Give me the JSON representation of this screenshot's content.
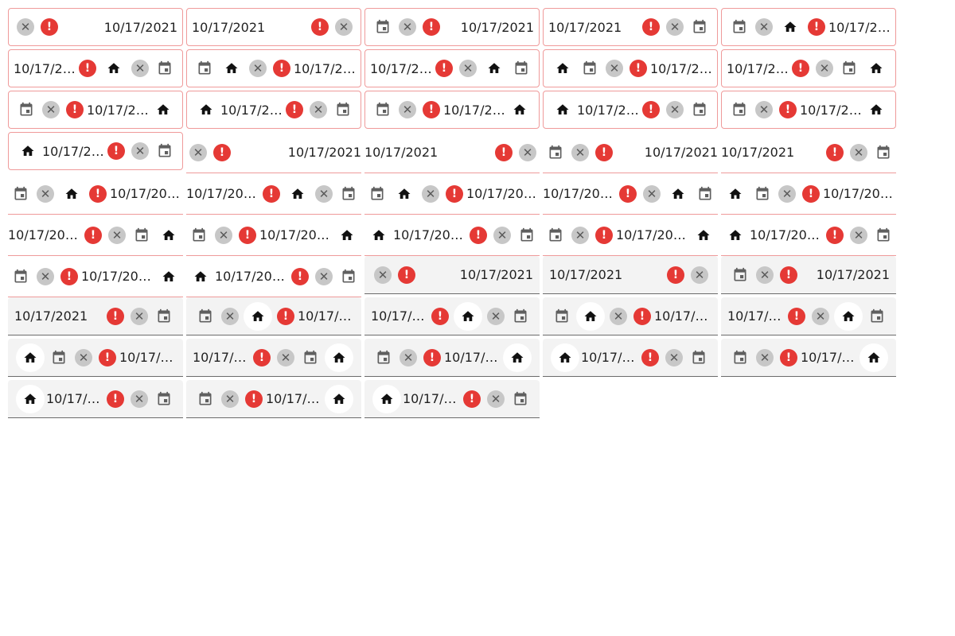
{
  "value": "10/17/2021",
  "colors": {
    "error": "#e53935",
    "clear_bg": "#c7c7c7",
    "outline": "#ef9a9a",
    "filled_bg": "#f3f3f3"
  },
  "icons": {
    "error": "exclamation-circle-icon",
    "clear": "clear-circle-icon",
    "calendar": "calendar-icon",
    "home": "home-icon"
  },
  "fields": [
    {
      "variant": "outlined",
      "layout": [
        "clr",
        "err",
        "date:right"
      ]
    },
    {
      "variant": "outlined",
      "layout": [
        "date:left",
        "err",
        "clr"
      ]
    },
    {
      "variant": "outlined",
      "layout": [
        "cal",
        "clr",
        "err",
        "date:right"
      ]
    },
    {
      "variant": "outlined",
      "layout": [
        "date:left",
        "err",
        "clr",
        "cal"
      ]
    },
    {
      "variant": "outlined",
      "layout": [
        "cal",
        "clr",
        "home",
        "err",
        "date:right"
      ]
    },
    {
      "variant": "outlined",
      "layout": [
        "date:left",
        "err",
        "home",
        "clr",
        "cal"
      ]
    },
    {
      "variant": "outlined",
      "layout": [
        "cal",
        "home",
        "clr",
        "err",
        "date:right"
      ]
    },
    {
      "variant": "outlined",
      "layout": [
        "date:left",
        "err",
        "clr",
        "home",
        "cal"
      ]
    },
    {
      "variant": "outlined",
      "layout": [
        "home",
        "cal",
        "clr",
        "err",
        "date:right"
      ]
    },
    {
      "variant": "outlined",
      "layout": [
        "date:left",
        "err",
        "clr",
        "cal",
        "home"
      ]
    },
    {
      "variant": "outlined",
      "layout": [
        "cal",
        "clr",
        "err",
        "date:right",
        "home"
      ]
    },
    {
      "variant": "outlined",
      "layout": [
        "home",
        "date:right",
        "err",
        "clr",
        "cal"
      ]
    },
    {
      "variant": "outlined",
      "layout": [
        "cal",
        "clr",
        "err",
        "date:right",
        "home"
      ]
    },
    {
      "variant": "outlined",
      "layout": [
        "home",
        "date:right",
        "err",
        "clr",
        "cal"
      ]
    },
    {
      "variant": "outlined",
      "layout": [
        "cal",
        "clr",
        "err",
        "date:right",
        "home"
      ]
    },
    {
      "variant": "outlined",
      "layout": [
        "home",
        "date:right",
        "err",
        "clr",
        "cal"
      ]
    },
    {
      "variant": "underlined",
      "layout": [
        "clr",
        "err",
        "date:right"
      ]
    },
    {
      "variant": "underlined",
      "layout": [
        "date:left",
        "err",
        "clr"
      ]
    },
    {
      "variant": "underlined",
      "layout": [
        "cal",
        "clr",
        "err",
        "date:right"
      ]
    },
    {
      "variant": "underlined",
      "layout": [
        "date:left",
        "err",
        "clr",
        "cal"
      ]
    },
    {
      "variant": "underlined",
      "layout": [
        "cal",
        "clr",
        "home",
        "err",
        "date:right"
      ]
    },
    {
      "variant": "underlined",
      "layout": [
        "date:left",
        "err",
        "home",
        "clr",
        "cal"
      ]
    },
    {
      "variant": "underlined",
      "layout": [
        "cal",
        "home",
        "clr",
        "err",
        "date:right"
      ]
    },
    {
      "variant": "underlined",
      "layout": [
        "date:left",
        "err",
        "clr",
        "home",
        "cal"
      ]
    },
    {
      "variant": "underlined",
      "layout": [
        "home",
        "cal",
        "clr",
        "err",
        "date:right"
      ]
    },
    {
      "variant": "underlined",
      "layout": [
        "date:left",
        "err",
        "clr",
        "cal",
        "home"
      ]
    },
    {
      "variant": "underlined",
      "layout": [
        "cal",
        "clr",
        "err",
        "date:right",
        "home"
      ]
    },
    {
      "variant": "underlined",
      "layout": [
        "home",
        "date:right",
        "err",
        "clr",
        "cal"
      ]
    },
    {
      "variant": "underlined",
      "layout": [
        "cal",
        "clr",
        "err",
        "date:right",
        "home"
      ]
    },
    {
      "variant": "underlined",
      "layout": [
        "home",
        "date:right",
        "err",
        "clr",
        "cal"
      ]
    },
    {
      "variant": "underlined",
      "layout": [
        "cal",
        "clr",
        "err",
        "date:right",
        "home"
      ]
    },
    {
      "variant": "underlined",
      "layout": [
        "home",
        "date:right",
        "err",
        "clr",
        "cal"
      ]
    },
    {
      "variant": "filled",
      "layout": [
        "clr",
        "err",
        "date:right"
      ]
    },
    {
      "variant": "filled",
      "layout": [
        "date:left",
        "err",
        "clr"
      ]
    },
    {
      "variant": "filled",
      "layout": [
        "cal",
        "clr",
        "err",
        "date:right"
      ]
    },
    {
      "variant": "filled",
      "layout": [
        "date:left",
        "err",
        "clr",
        "cal"
      ]
    },
    {
      "variant": "filled",
      "layout": [
        "cal",
        "clr",
        "homeb",
        "err",
        "date:right"
      ]
    },
    {
      "variant": "filled",
      "layout": [
        "date:left",
        "err",
        "homeb",
        "clr",
        "cal"
      ]
    },
    {
      "variant": "filled",
      "layout": [
        "cal",
        "homeb",
        "clr",
        "err",
        "date:right"
      ]
    },
    {
      "variant": "filled",
      "layout": [
        "date:left",
        "err",
        "clr",
        "homeb",
        "cal"
      ]
    },
    {
      "variant": "filled",
      "layout": [
        "homeb",
        "cal",
        "clr",
        "err",
        "date:right"
      ]
    },
    {
      "variant": "filled",
      "layout": [
        "date:left",
        "err",
        "clr",
        "cal",
        "homeb"
      ]
    },
    {
      "variant": "filled",
      "layout": [
        "cal",
        "clr",
        "err",
        "date:right",
        "homeb"
      ]
    },
    {
      "variant": "filled",
      "layout": [
        "homeb",
        "date:right",
        "err",
        "clr",
        "cal"
      ]
    },
    {
      "variant": "filled",
      "layout": [
        "cal",
        "clr",
        "err",
        "date:right",
        "homeb"
      ]
    },
    {
      "variant": "filled",
      "layout": [
        "homeb",
        "date:right",
        "err",
        "clr",
        "cal"
      ]
    },
    {
      "variant": "filled",
      "layout": [
        "cal",
        "clr",
        "err",
        "date:right",
        "homeb"
      ]
    },
    {
      "variant": "filled",
      "layout": [
        "homeb",
        "date:right",
        "err",
        "clr",
        "cal"
      ]
    }
  ]
}
